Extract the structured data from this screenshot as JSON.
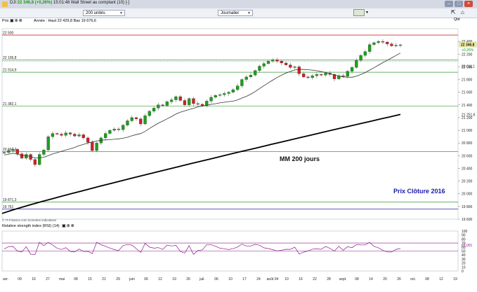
{
  "window": {
    "ticker": "DJI",
    "price": "22 346,8",
    "change": "(+0,26%)",
    "title_rest": "15:01:48 Wall Street au comptant (10) [-]"
  },
  "toolbar": {
    "units": "200 unités",
    "period": "Journalier",
    "zoom_label": "Qté"
  },
  "chart_header": {
    "label": "Prix",
    "info": "Année : Haut 22 429,8 Bas 19 676,6"
  },
  "annotations": {
    "ma_label": "MM 200 jours",
    "close_label": "Prix Clôture 2016",
    "source": "© IT-Finance.com Données indicatives",
    "last_price_tag": "22 346,8",
    "pct_tag": "+0,26%"
  },
  "levels": [
    {
      "value": "22 500",
      "y": 22500
    },
    {
      "value": "22 106,8",
      "y": 22106.8
    },
    {
      "value": "21 914,9",
      "y": 21914.9
    },
    {
      "value": "21 382,1",
      "y": 21382.1
    },
    {
      "value": "20 663,2",
      "y": 20663.2
    },
    {
      "value": "19 871,3",
      "y": 19871.3
    },
    {
      "value": "19 761",
      "y": 19761
    }
  ],
  "right_tags": [
    {
      "text": "22 011,1",
      "y": 22011.1
    },
    {
      "text": "21 251,6",
      "y": 21251.6
    }
  ],
  "rsi": {
    "label": "Relative strength index (RSI) (14)",
    "last": "65,001",
    "upper": 70,
    "lower": 50,
    "ticks": [
      "100",
      "90",
      "80",
      "70",
      "60",
      "50",
      "40",
      "30",
      "20",
      "10",
      "0"
    ]
  },
  "colors": {
    "up": "#1d9e1d",
    "down": "#d42020",
    "ma_short": "#333333",
    "ma200": "#000000",
    "level_green": "#3a9a3a",
    "level_red": "#d03030",
    "level_blue": "#2a2ab0",
    "rsi": "#8a1a8a"
  },
  "chart_data": {
    "type": "candlestick",
    "title": "DJI",
    "ylim": [
      19600,
      22600
    ],
    "y_ticks": [
      "22 400",
      "22 200",
      "22 000",
      "21 800",
      "21 600",
      "21 400",
      "21 200",
      "21 000",
      "20 800",
      "20 600",
      "20 400",
      "20 200",
      "20 000",
      "19 800",
      "19 600"
    ],
    "x_ticks": [
      "avr.",
      "09",
      "16",
      "27",
      "mai",
      "08",
      "15",
      "21",
      "29",
      "juin",
      "06",
      "12",
      "19",
      "26",
      "juil.",
      "06",
      "10",
      "17",
      "24",
      "août 04",
      "10",
      "16",
      "22",
      "28",
      "sept.",
      "08",
      "14",
      "20",
      "26",
      "oct.",
      "08",
      "12",
      "19"
    ],
    "closes": [
      20650,
      20680,
      20700,
      20630,
      20560,
      20620,
      20540,
      20460,
      20620,
      20690,
      20900,
      20950,
      20940,
      20920,
      20960,
      20940,
      20910,
      20930,
      20880,
      20810,
      20680,
      20800,
      20880,
      20950,
      21000,
      21020,
      21010,
      21080,
      21150,
      21200,
      21180,
      21100,
      21230,
      21300,
      21350,
      21400,
      21390,
      21450,
      21480,
      21530,
      21470,
      21400,
      21500,
      21420,
      21410,
      21390,
      21460,
      21520,
      21550,
      21560,
      21580,
      21600,
      21640,
      21700,
      21800,
      21840,
      21870,
      21940,
      22010,
      22050,
      22090,
      22110,
      22090,
      22060,
      22030,
      21990,
      22000,
      21890,
      21840,
      21830,
      21860,
      21880,
      21870,
      21900,
      21880,
      21810,
      21860,
      21850,
      21930,
      21990,
      22100,
      22180,
      22240,
      22350,
      22380,
      22400,
      22390,
      22360,
      22330,
      22340,
      22346
    ]
  }
}
